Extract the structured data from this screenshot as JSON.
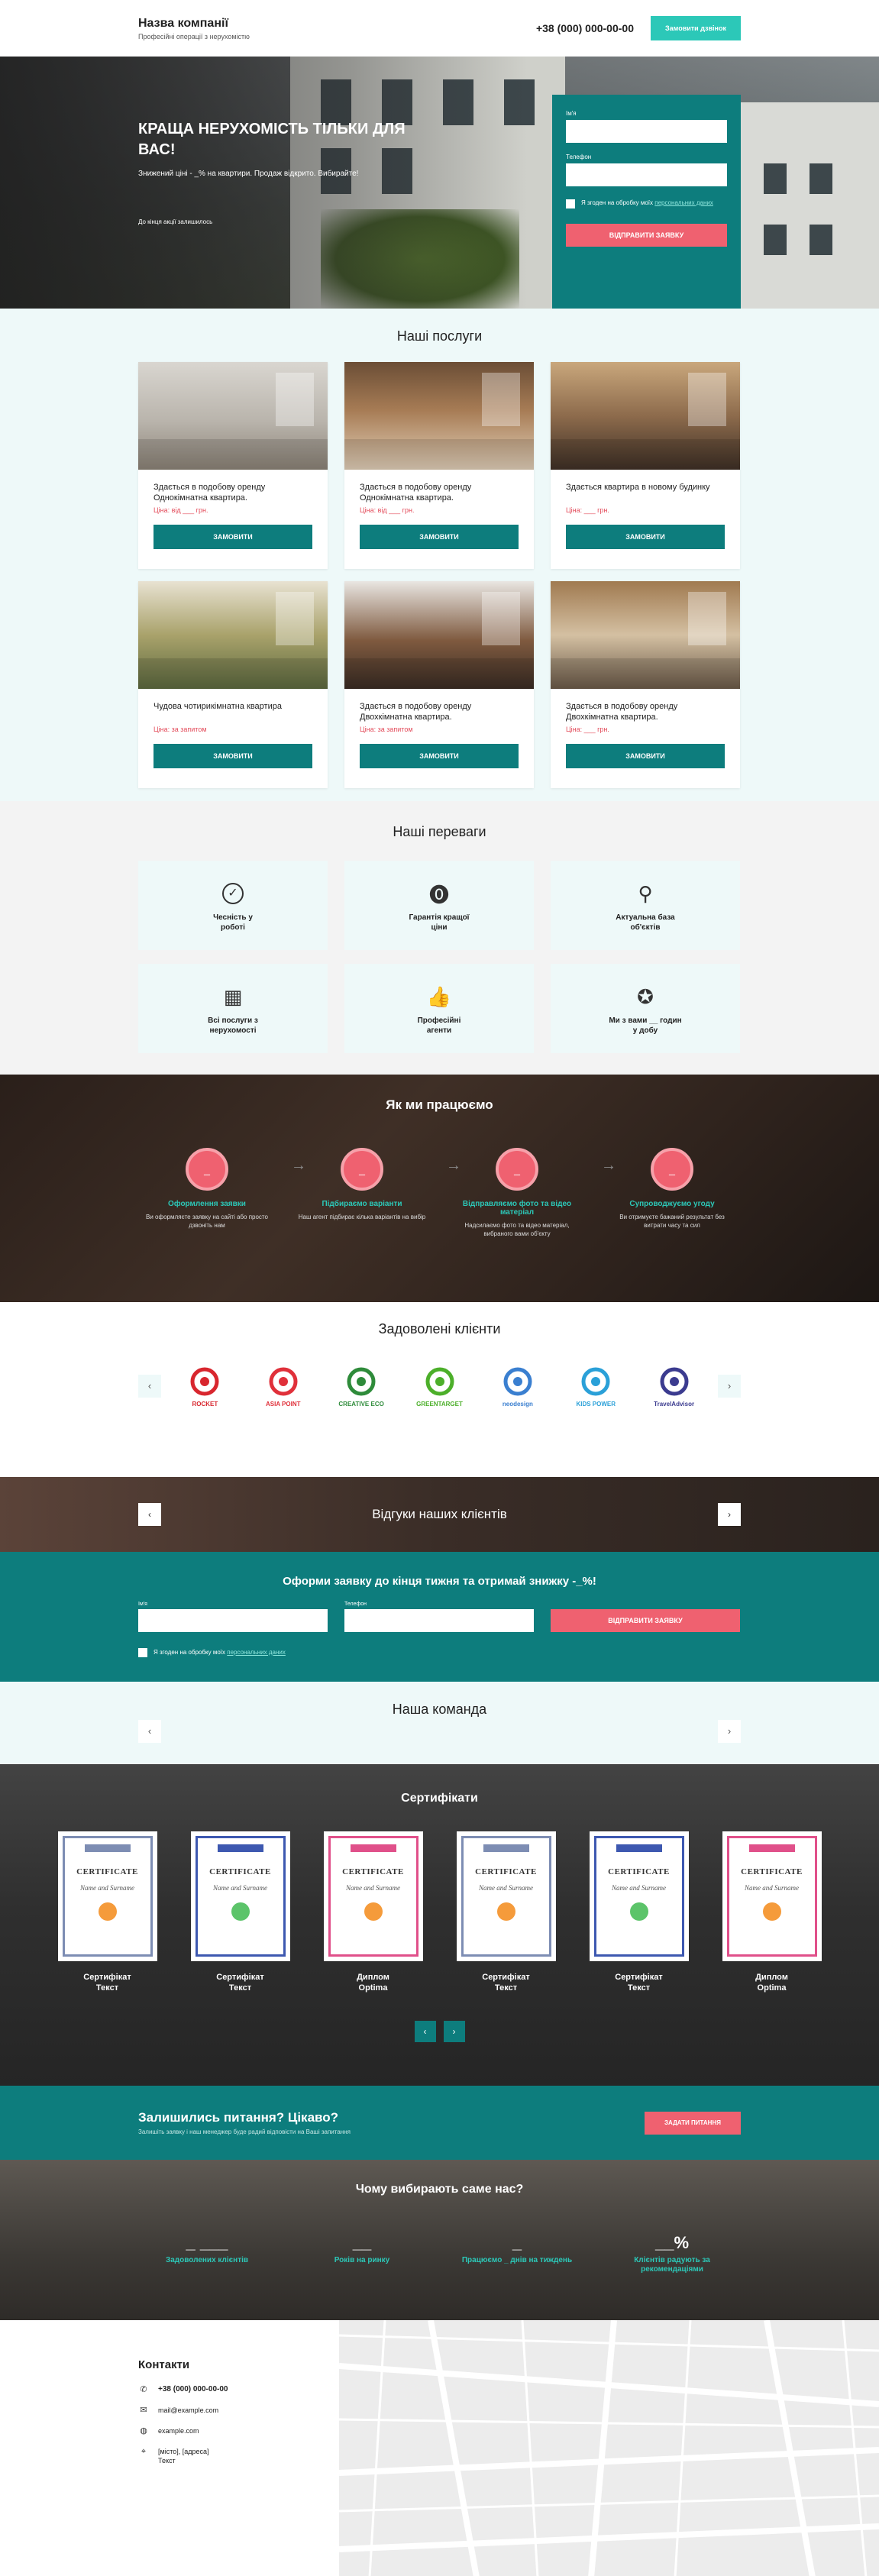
{
  "header": {
    "company_name": "Назва компанії",
    "company_tagline": "Професійні операції з нерухомістю",
    "phone": "+38 (000) 000-00-00",
    "callback_label": "Замовити дзвінок"
  },
  "hero": {
    "title": "КРАЩА НЕРУХОМІСТЬ ТІЛЬКИ ДЛЯ ВАС!",
    "subtitle": "Знижений ціні - _% на квартири. Продаж відкрито. Вибирайте!",
    "countdown_label": "До кінця акції залишилось",
    "form": {
      "name_label": "Ім'я",
      "phone_label": "Телефон",
      "agree_text": "Я згоден на обробку моїх",
      "agree_link": "персональних даних",
      "submit_label": "ВІДПРАВИТИ ЗАЯВКУ"
    }
  },
  "services": {
    "title": "Наші послуги",
    "order_label": "ЗАМОВИТИ",
    "items": [
      {
        "title": "Здається в подобову оренду Однокімнатна квартира.",
        "price": "Ціна: від ___ грн."
      },
      {
        "title": "Здається в подобову оренду Однокімнатна квартира.",
        "price": "Ціна: від ___ грн."
      },
      {
        "title": "Здається квартира в новому будинку",
        "price": "Ціна: ___ грн."
      },
      {
        "title": "Чудова чотирикімнатна квартира",
        "price": "Ціна: за запитом"
      },
      {
        "title": "Здається в подобову оренду Двохкімнатна квартира.",
        "price": "Ціна: за запитом"
      },
      {
        "title": "Здається в подобову оренду Двохкімнатна квартира.",
        "price": "Ціна: ___ грн."
      }
    ]
  },
  "advantages": {
    "title": "Наші переваги",
    "items": [
      {
        "icon": "check-circle-icon",
        "text": "Чесність у\nроботі"
      },
      {
        "icon": "coins-icon",
        "text": "Гарантія кращої\nціни"
      },
      {
        "icon": "magnifier-icon",
        "text": "Актуальна база\nоб'єктів"
      },
      {
        "icon": "qr-code-icon",
        "text": "Всі послуги з\nнерухомості"
      },
      {
        "icon": "thumbs-up-icon",
        "text": "Професійні\nагенти"
      },
      {
        "icon": "award-icon",
        "text": "Ми з вами __ годин\nу добу"
      }
    ]
  },
  "how": {
    "title": "Як ми працюємо",
    "steps": [
      {
        "num": "_",
        "title": "Оформлення заявки",
        "desc": "Ви оформляєте заявку на сайті або просто дзвоніть нам"
      },
      {
        "num": "_",
        "title": "Підбираємо варіанти",
        "desc": "Наш агент підбирає кілька варіантів на вибір"
      },
      {
        "num": "_",
        "title": "Відправляємо фото та відео матеріал",
        "desc": "Надсилаємо фото та відео матеріал, вибраного вами об'єкту"
      },
      {
        "num": "_",
        "title": "Супроводжуємо угоду",
        "desc": "Ви отримуєте бажаний результат без витрати часу та сил"
      }
    ]
  },
  "clients": {
    "title": "Задоволені клієнти",
    "logos": [
      {
        "name": "ROCKET",
        "color": "#d8262e"
      },
      {
        "name": "ASIA POINT",
        "color": "#e0303a"
      },
      {
        "name": "CREATIVE ECO",
        "color": "#2e8b3a"
      },
      {
        "name": "GREENTARGET",
        "color": "#4caf2a"
      },
      {
        "name": "neodesign",
        "color": "#3a7fd0"
      },
      {
        "name": "KIDS POWER",
        "color": "#2aa0d8"
      },
      {
        "name": "TravelAdvisor",
        "color": "#3b3b8f"
      }
    ]
  },
  "reviews": {
    "title": "Відгуки наших клієнтів"
  },
  "discount": {
    "title": "Оформи заявку до кінця тижня та отримай знижку -_%!",
    "name_label": "Ім'я",
    "phone_label": "Телефон",
    "submit_label": "ВІДПРАВИТИ ЗАЯВКУ",
    "agree_text": "Я згоден на обробку моїх",
    "agree_link": "персональних даних"
  },
  "team": {
    "title": "Наша команда"
  },
  "certificates": {
    "title": "Сертифікати",
    "cert_heading": "CERTIFICATE",
    "cert_name": "Name and Surname",
    "items": [
      {
        "label": "Сертифікат\nТекст",
        "color": "#7d8db3"
      },
      {
        "label": "Сертифікат\nТекст",
        "color": "#3d58b0"
      },
      {
        "label": "Диплом\nOptima",
        "color": "#e0508a"
      },
      {
        "label": "Сертифікат\nТекст",
        "color": "#7d8db3"
      },
      {
        "label": "Сертифікат\nТекст",
        "color": "#3d58b0"
      },
      {
        "label": "Диплом\nOptima",
        "color": "#e0508a"
      }
    ]
  },
  "questions": {
    "title": "Залишились питання? Цікаво?",
    "subtitle": "Залишіть заявку і наш менеджер буде радий відповісти на Ваші запитання",
    "button_label": "ЗАДАТИ ПИТАННЯ"
  },
  "why": {
    "title": "Чому вибирають саме нас?",
    "stats": [
      {
        "value": "_ ___",
        "label": "Задоволених клієнтів"
      },
      {
        "value": "__",
        "label": "Років на ринку"
      },
      {
        "value": "_",
        "label": "Працюємо _ днів на тиждень"
      },
      {
        "value": "__%",
        "label": "Клієнтів радують за рекомендаціями"
      }
    ]
  },
  "contacts": {
    "title": "Контакти",
    "phone": "+38 (000) 000-00-00",
    "email": "mail@example.com",
    "site": "example.com",
    "address": "[місто], [адреса]\nТекст"
  },
  "colors": {
    "teal": "#0d7d7d",
    "aqua": "#2cc8b8",
    "coral": "#ef6170",
    "light_bg": "#eef9f9"
  }
}
